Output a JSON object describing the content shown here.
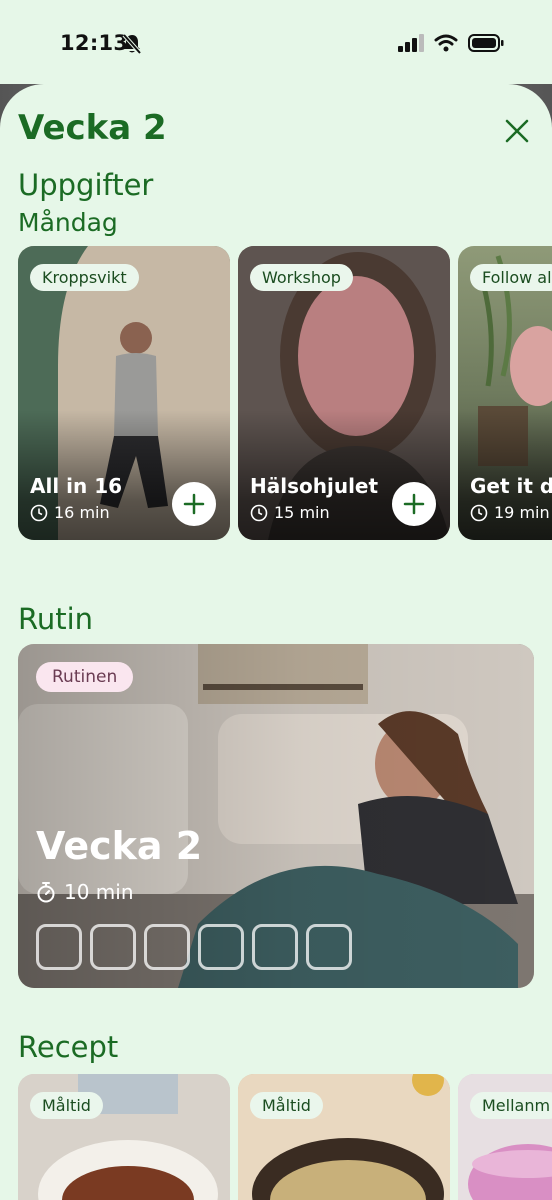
{
  "status": {
    "time": "12:13"
  },
  "header": {
    "title": "Vecka 2"
  },
  "tasks": {
    "section_title": "Uppgifter",
    "day": "Måndag",
    "cards": [
      {
        "tag": "Kroppsvikt",
        "title": "All in 16",
        "duration": "16 min"
      },
      {
        "tag": "Workshop",
        "title": "Hälsohjulet",
        "duration": "15 min"
      },
      {
        "tag": "Follow al",
        "title": "Get it do",
        "duration": "19 min"
      }
    ]
  },
  "routine": {
    "section_title": "Rutin",
    "tag": "Rutinen",
    "title": "Vecka 2",
    "duration": "10 min",
    "progress_total": 6,
    "progress_done": 0
  },
  "recipes": {
    "section_title": "Recept",
    "cards": [
      {
        "tag": "Måltid"
      },
      {
        "tag": "Måltid"
      },
      {
        "tag": "Mellanm"
      }
    ]
  },
  "colors": {
    "accent": "#1b6b24",
    "background": "#e6f7e8"
  }
}
